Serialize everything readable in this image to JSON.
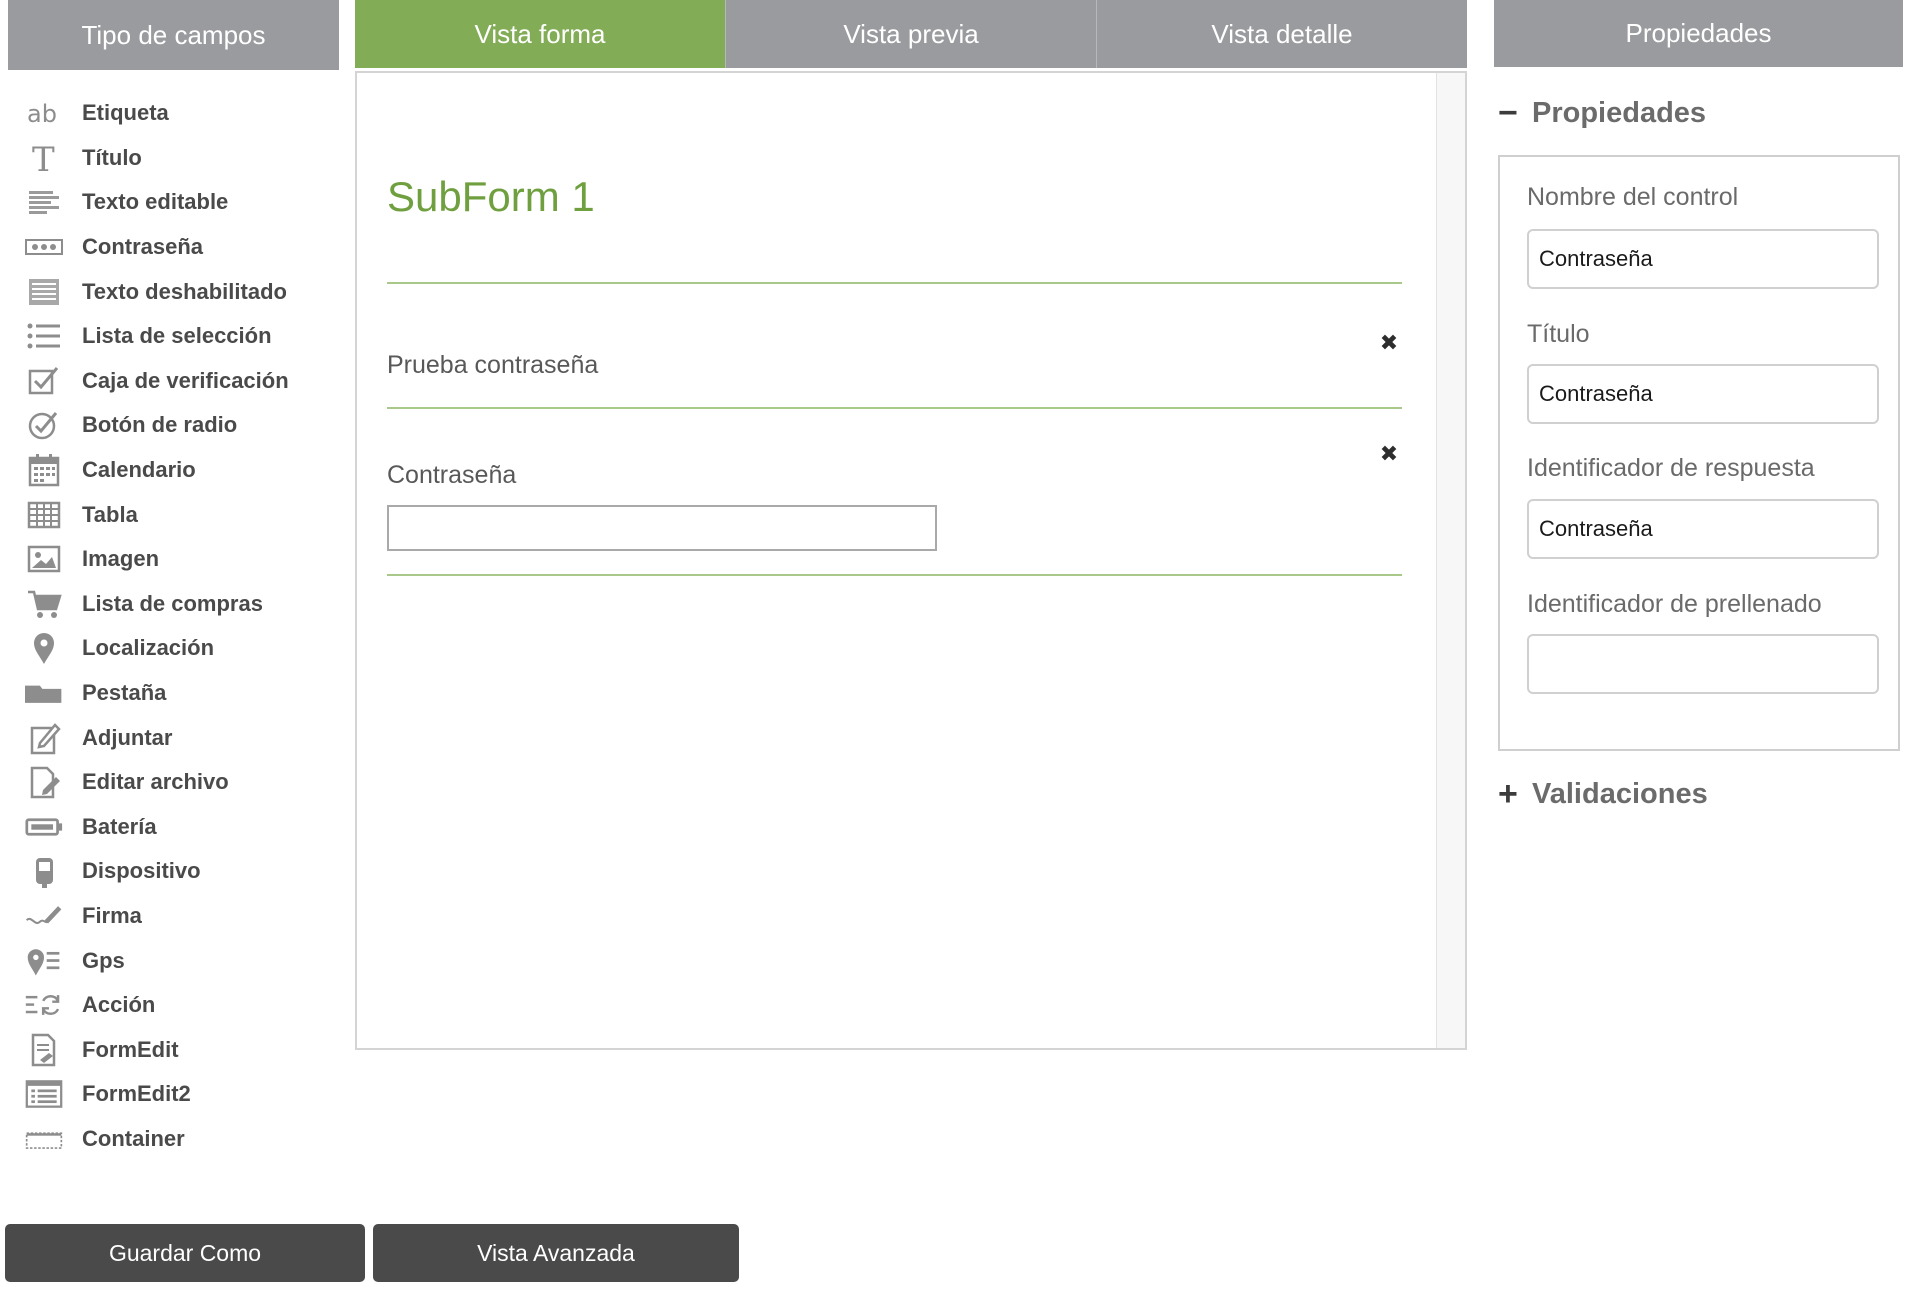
{
  "left_panel": {
    "header": "Tipo de campos",
    "items": [
      {
        "label": "Etiqueta",
        "icon": "ab-text-icon"
      },
      {
        "label": "Título",
        "icon": "title-t-icon"
      },
      {
        "label": "Texto editable",
        "icon": "editable-text-icon"
      },
      {
        "label": "Contraseña",
        "icon": "password-dots-icon"
      },
      {
        "label": "Texto deshabilitado",
        "icon": "disabled-text-icon"
      },
      {
        "label": "Lista de selección",
        "icon": "bullet-list-icon"
      },
      {
        "label": "Caja de verificación",
        "icon": "checkbox-icon"
      },
      {
        "label": "Botón de radio",
        "icon": "radio-check-icon"
      },
      {
        "label": "Calendario",
        "icon": "calendar-icon"
      },
      {
        "label": "Tabla",
        "icon": "table-grid-icon"
      },
      {
        "label": "Imagen",
        "icon": "image-icon"
      },
      {
        "label": "Lista de compras",
        "icon": "shopping-cart-icon"
      },
      {
        "label": "Localización",
        "icon": "map-pin-icon"
      },
      {
        "label": "Pestaña",
        "icon": "folder-tab-icon"
      },
      {
        "label": "Adjuntar",
        "icon": "attach-edit-icon"
      },
      {
        "label": "Editar archivo",
        "icon": "edit-file-icon"
      },
      {
        "label": "Batería",
        "icon": "battery-icon"
      },
      {
        "label": "Dispositivo",
        "icon": "device-phone-icon"
      },
      {
        "label": "Firma",
        "icon": "signature-pen-icon"
      },
      {
        "label": "Gps",
        "icon": "gps-pin-list-icon"
      },
      {
        "label": "Acción",
        "icon": "action-refresh-icon"
      },
      {
        "label": "FormEdit",
        "icon": "form-edit-icon"
      },
      {
        "label": "FormEdit2",
        "icon": "form-edit2-icon"
      },
      {
        "label": "Container",
        "icon": "container-dashed-icon"
      }
    ]
  },
  "tabs": [
    {
      "label": "Vista forma",
      "active": true
    },
    {
      "label": "Vista previa",
      "active": false
    },
    {
      "label": "Vista detalle",
      "active": false
    }
  ],
  "canvas": {
    "subform_title": "SubForm 1",
    "fields": [
      {
        "label": "Prueba contraseña",
        "close_icon": "close-x-icon"
      },
      {
        "label": "Contraseña",
        "close_icon": "close-x-icon",
        "input_value": ""
      }
    ]
  },
  "right_panel": {
    "header": "Propiedades",
    "properties_section": {
      "toggle": "−",
      "title": "Propiedades"
    },
    "fields": [
      {
        "label": "Nombre del control",
        "value": "Contraseña"
      },
      {
        "label": "Título",
        "value": "Contraseña"
      },
      {
        "label": "Identificador de respuesta",
        "value": "Contraseña"
      },
      {
        "label": "Identificador de prellenado",
        "value": ""
      }
    ],
    "validations_section": {
      "toggle": "+",
      "title": "Validaciones"
    }
  },
  "buttons": {
    "save_as": "Guardar Como",
    "advanced_view": "Vista Avanzada"
  },
  "colors": {
    "header_gray": "#9a9b9e",
    "accent_green": "#82ac55",
    "title_green": "#6f9f3e",
    "button_dark": "#4a4a4a"
  }
}
